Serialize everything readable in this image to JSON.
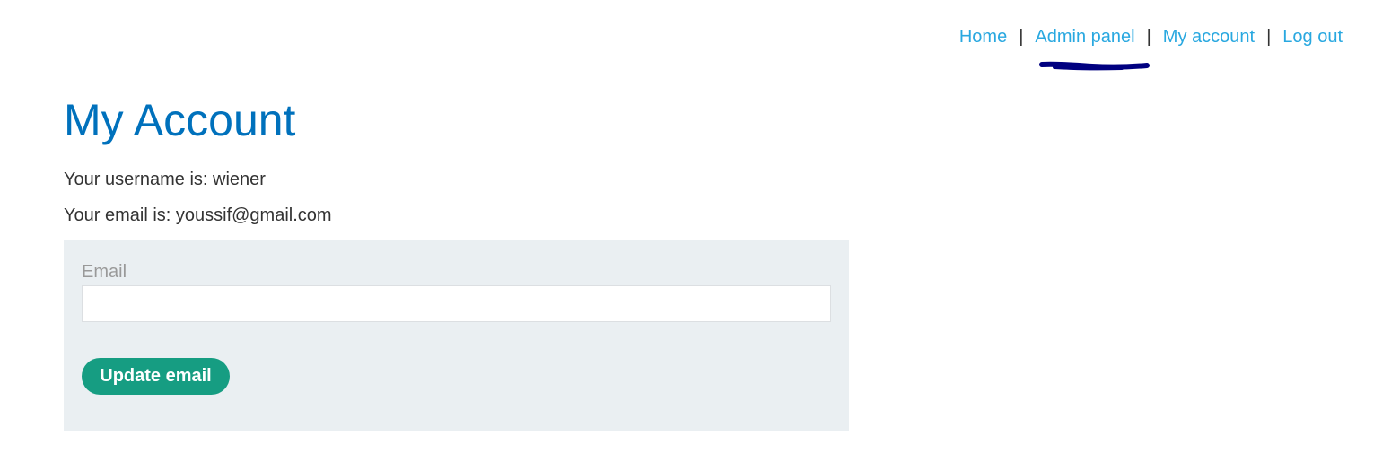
{
  "nav": {
    "items": [
      {
        "label": "Home"
      },
      {
        "label": "Admin panel"
      },
      {
        "label": "My account"
      },
      {
        "label": "Log out"
      }
    ],
    "separator": "|"
  },
  "annotation": {
    "color": "#000080"
  },
  "account": {
    "title": "My Account",
    "username_line": "Your username is: wiener",
    "email_line": "Your email is: youssif@gmail.com"
  },
  "form": {
    "email_label": "Email",
    "email_value": "",
    "update_button_label": "Update email"
  },
  "colors": {
    "link": "#29a8e0",
    "title": "#0071bc",
    "panel_bg": "#eaeff2",
    "button_bg": "#169d82"
  }
}
